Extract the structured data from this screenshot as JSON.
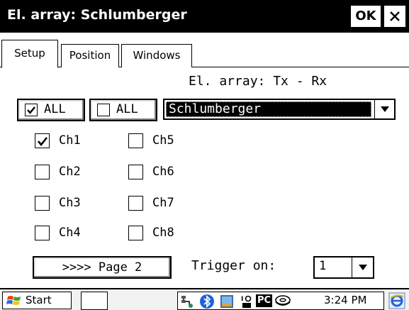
{
  "window": {
    "title": "El. array: Schlumberger",
    "ok_label": "OK"
  },
  "tabs": [
    {
      "label": "Setup",
      "active": true
    },
    {
      "label": "Position",
      "active": false
    },
    {
      "label": "Windows",
      "active": false
    }
  ],
  "setup": {
    "array_label": "El. array: Tx - Rx",
    "all_checked_label": "ALL",
    "all_unchecked_label": "ALL",
    "array_select_value": "Schlumberger",
    "channels": [
      {
        "label": "Ch1",
        "checked": true
      },
      {
        "label": "Ch2",
        "checked": false
      },
      {
        "label": "Ch3",
        "checked": false
      },
      {
        "label": "Ch4",
        "checked": false
      },
      {
        "label": "Ch5",
        "checked": false
      },
      {
        "label": "Ch6",
        "checked": false
      },
      {
        "label": "Ch7",
        "checked": false
      },
      {
        "label": "Ch8",
        "checked": false
      }
    ],
    "page_button_label": ">>>> Page 2",
    "trigger_label": "Trigger on:",
    "trigger_value": "1"
  },
  "taskbar": {
    "start_label": "Start",
    "tray_pc": "PC",
    "clock": "3:24 PM"
  }
}
